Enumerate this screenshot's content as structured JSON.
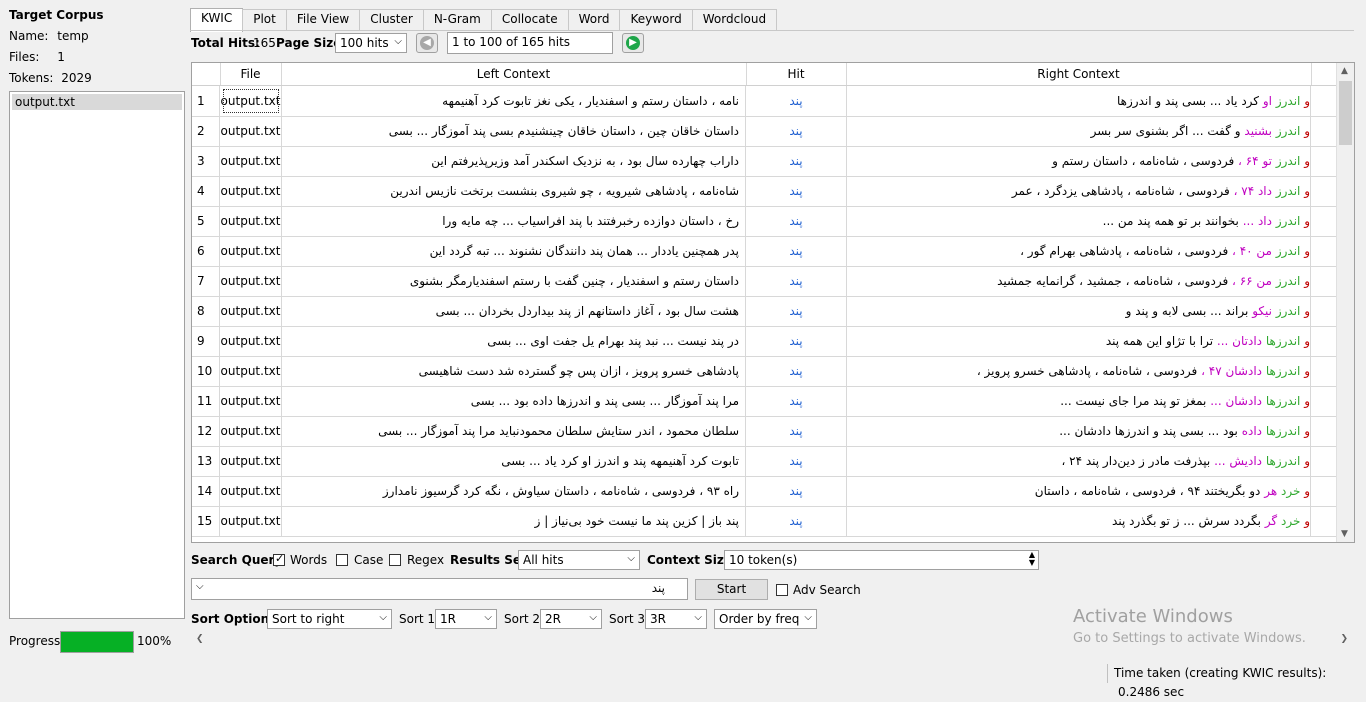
{
  "left_panel": {
    "title": "Target Corpus",
    "name_label": "Name:",
    "name_value": "temp",
    "files_label": "Files:",
    "files_value": "1",
    "tokens_label": "Tokens:",
    "tokens_value": "2029",
    "files": [
      "output.txt"
    ],
    "progress_label": "Progress",
    "progress_value": "100%",
    "progress_fraction": 1.0
  },
  "tabs": [
    "KWIC",
    "Plot",
    "File View",
    "Cluster",
    "N-Gram",
    "Collocate",
    "Word",
    "Keyword",
    "Wordcloud"
  ],
  "active_tab": "KWIC",
  "hits_bar": {
    "total_hits_label": "Total Hits:",
    "total_hits_value": "165",
    "page_size_label": "Page Size",
    "page_size_value": "100 hits",
    "range_text": "1 to 100 of 165 hits"
  },
  "table": {
    "columns": [
      "",
      "File",
      "Left Context",
      "Hit",
      "Right Context"
    ],
    "rows": [
      {
        "idx": "1",
        "file": "output.txt",
        "left": "نامه ، داستان رستم و اسفندیار ، یکی نغز تابوت کرد آهنیمهه",
        "hit": "پند",
        "r1": "و",
        "r2": "اندرز",
        "r3": "او",
        "rest": "کرد یاد ... بسی پند و اندرزها"
      },
      {
        "idx": "2",
        "file": "output.txt",
        "left": "داستان خاقان چین ، داستان خاقان چینشنیدم بسی پند آموزگار ... بسی",
        "hit": "پند",
        "r1": "و",
        "r2": "اندرز",
        "r3": "بشنید",
        "rest": "و گفت ... اگر بشنوی سر بسر"
      },
      {
        "idx": "3",
        "file": "output.txt",
        "left": "داراب چهارده سال بود ، به نزدیک اسکندر آمد وزیرپذیرفتم این",
        "hit": "پند",
        "r1": "و",
        "r2": "اندرز",
        "r3": "تو ۶۴ ،",
        "rest": "فردوسی ، شاه‌نامه ، داستان رستم و"
      },
      {
        "idx": "4",
        "file": "output.txt",
        "left": "شاه‌نامه ، پادشاهی شیرویه ، چو شیروی بنشست برتخت نازیس اندرین",
        "hit": "پند",
        "r1": "و",
        "r2": "اندرز",
        "r3": "داد ۷۴ ،",
        "rest": "فردوسی ، شاه‌نامه ، پادشاهی یزدگرد ، عمر"
      },
      {
        "idx": "5",
        "file": "output.txt",
        "left": "رخ ، داستان دوازده رخبرفتند با پند افراسیاب ... چه مایه ورا",
        "hit": "پند",
        "r1": "و",
        "r2": "اندرز",
        "r3": "داد ...",
        "rest": "بخوانند بر تو همه پند من ..."
      },
      {
        "idx": "6",
        "file": "output.txt",
        "left": "پدر همچنین یاددار ... همان پند دانندگان نشنوند ... تبه گردد این",
        "hit": "پند",
        "r1": "و",
        "r2": "اندرز",
        "r3": "من ۴۰ ،",
        "rest": "فردوسی ، شاه‌نامه ، پادشاهی بهرام گور ،"
      },
      {
        "idx": "7",
        "file": "output.txt",
        "left": "داستان رستم و اسفندیار ، چنین گفت با رستم اسفندیارمگر بشنوی",
        "hit": "پند",
        "r1": "و",
        "r2": "اندرز",
        "r3": "من ۶۶ ،",
        "rest": "فردوسی ، شاه‌نامه ، جمشید ، گرانمایه جمشید"
      },
      {
        "idx": "8",
        "file": "output.txt",
        "left": "هشت سال بود ، آغاز داستانهم از پند بیداردل بخردان ... بسی",
        "hit": "پند",
        "r1": "و",
        "r2": "اندرز",
        "r3": "نیکو",
        "rest": "براند ... بسی لابه و پند و"
      },
      {
        "idx": "9",
        "file": "output.txt",
        "left": "در پند نیست ... نبد پند بهرام یل جفت اوی ... بسی",
        "hit": "پند",
        "r1": "و",
        "r2": "اندرزها",
        "r3": "دادتان ...",
        "rest": "ترا با تژاو این همه پند"
      },
      {
        "idx": "10",
        "file": "output.txt",
        "left": "پادشاهی خسرو پرویز ، ازان پس چو گسترده شد دست شاهیسی",
        "hit": "پند",
        "r1": "و",
        "r2": "اندرزها",
        "r3": "دادشان ۴۷ ،",
        "rest": "فردوسی ، شاه‌نامه ، پادشاهی خسرو پرویز ،"
      },
      {
        "idx": "11",
        "file": "output.txt",
        "left": "مرا پند آموزگار ... بسی پند و اندرزها داده بود ... بسی",
        "hit": "پند",
        "r1": "و",
        "r2": "اندرزها",
        "r3": "دادشان ...",
        "rest": "بمغز تو پند مرا جای نیست ..."
      },
      {
        "idx": "12",
        "file": "output.txt",
        "left": "سلطان محمود ، اندر ستایش سلطان محمودنباید مرا پند آموزگار ... بسی",
        "hit": "پند",
        "r1": "و",
        "r2": "اندرزها",
        "r3": "داده",
        "rest": "بود ... بسی پند و اندرزها دادشان ..."
      },
      {
        "idx": "13",
        "file": "output.txt",
        "left": "تابوت کرد آهنیمهه پند و اندرز او کرد یاد ... بسی",
        "hit": "پند",
        "r1": "و",
        "r2": "اندرزها",
        "r3": "دادیش ...",
        "rest": "بپذرفت مادر ز دین‌دار پند ۲۴ ،"
      },
      {
        "idx": "14",
        "file": "output.txt",
        "left": "راه ۹۳ ، فردوسی ، شاه‌نامه ، داستان سیاوش ، نگه کرد گرسیوز نامدارز",
        "hit": "پند",
        "r1": "و",
        "r2": "خرد",
        "r3": "هر",
        "rest": "دو بگریختند ۹۴ ، فردوسی ، شاه‌نامه ، داستان"
      },
      {
        "idx": "15",
        "file": "output.txt",
        "left": "پند باز | کزین پند ما نیست خود بی‌نیاز | ز",
        "hit": "پند",
        "r1": "و",
        "r2": "خرد",
        "r3": "گر",
        "rest": "بگردد سرش ... ز تو بگذرد پند"
      }
    ]
  },
  "search": {
    "query_label": "Search Query",
    "words_label": "Words",
    "words_checked": true,
    "case_label": "Case",
    "case_checked": false,
    "regex_label": "Regex",
    "regex_checked": false,
    "results_set_label": "Results Set",
    "results_set_value": "All hits",
    "context_size_label": "Context Size",
    "context_size_value": "10 token(s)",
    "query_value": "پند",
    "start_label": "Start",
    "adv_search_label": "Adv Search",
    "adv_search_checked": false
  },
  "sort": {
    "label": "Sort Options",
    "sort_mode": "Sort to right",
    "sort1_label": "Sort 1",
    "sort1_value": "1R",
    "sort2_label": "Sort 2",
    "sort2_value": "2R",
    "sort3_label": "Sort 3",
    "sort3_value": "3R",
    "order_value": "Order by freq"
  },
  "watermark": {
    "line1": "Activate Windows",
    "line2": "Go to Settings to activate Windows."
  },
  "status": {
    "label": "Time taken (creating KWIC results):",
    "value": "0.2486 sec"
  },
  "colors": {
    "progress": "#06b025",
    "hit": "#1e5fd1",
    "r1": "#c00000",
    "r2": "#2ea82e",
    "r3": "#c000c0"
  },
  "icons": {
    "prev": "arrow-left-circle-icon",
    "next": "arrow-right-circle-icon"
  }
}
